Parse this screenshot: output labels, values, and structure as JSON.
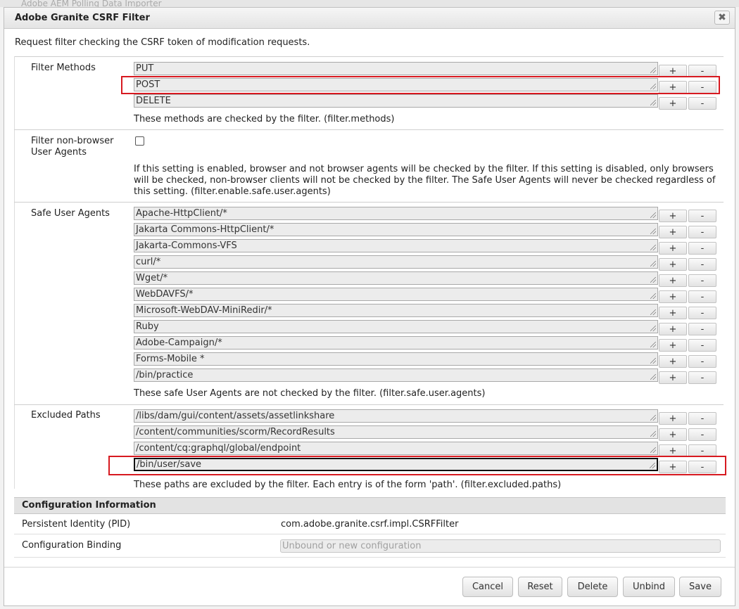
{
  "background": {
    "partial_title": "Adobe AEM Polling Data Importer"
  },
  "dialog": {
    "title": "Adobe Granite CSRF Filter",
    "close_symbol": "✖",
    "description": "Request filter checking the CSRF token of modification requests."
  },
  "filter_methods": {
    "label": "Filter Methods",
    "values": [
      "PUT",
      "POST",
      "DELETE"
    ],
    "help": "These methods are checked by the filter. (filter.methods)"
  },
  "non_browser": {
    "label_line1": "Filter non-browser",
    "label_line2": "User Agents",
    "checked": false,
    "help": "If this setting is enabled, browser and not browser agents will be checked by the filter. If this setting is disabled, only browsers will be checked, non-browser clients will not be checked by the filter. The Safe User Agents will never be checked regardless of this setting. (filter.enable.safe.user.agents)"
  },
  "safe_user_agents": {
    "label": "Safe User Agents",
    "values": [
      "Apache-HttpClient/*",
      "Jakarta Commons-HttpClient/*",
      "Jakarta-Commons-VFS",
      "curl/*",
      "Wget/*",
      "WebDAVFS/*",
      "Microsoft-WebDAV-MiniRedir/*",
      "Ruby",
      "Adobe-Campaign/*",
      "Forms-Mobile *",
      "/bin/practice"
    ],
    "help": "These safe User Agents are not checked by the filter. (filter.safe.user.agents)"
  },
  "excluded_paths": {
    "label": "Excluded Paths",
    "values": [
      "/libs/dam/gui/content/assets/assetlinkshare",
      "/content/communities/scorm/RecordResults",
      "/content/cq:graphql/global/endpoint",
      "/bin/user/save"
    ],
    "help": "These paths are excluded by the filter. Each entry is of the form 'path'. (filter.excluded.paths)"
  },
  "row_buttons": {
    "add": "+",
    "remove": "-"
  },
  "config_info": {
    "header": "Configuration Information",
    "pid_label": "Persistent Identity (PID)",
    "pid_value": "com.adobe.granite.csrf.impl.CSRFFilter",
    "binding_label": "Configuration Binding",
    "binding_placeholder": "Unbound or new configuration"
  },
  "footer": {
    "cancel": "Cancel",
    "reset": "Reset",
    "delete": "Delete",
    "unbind": "Unbind",
    "save": "Save"
  },
  "colors": {
    "highlight": "#d71920",
    "field_bg": "#ececec"
  }
}
